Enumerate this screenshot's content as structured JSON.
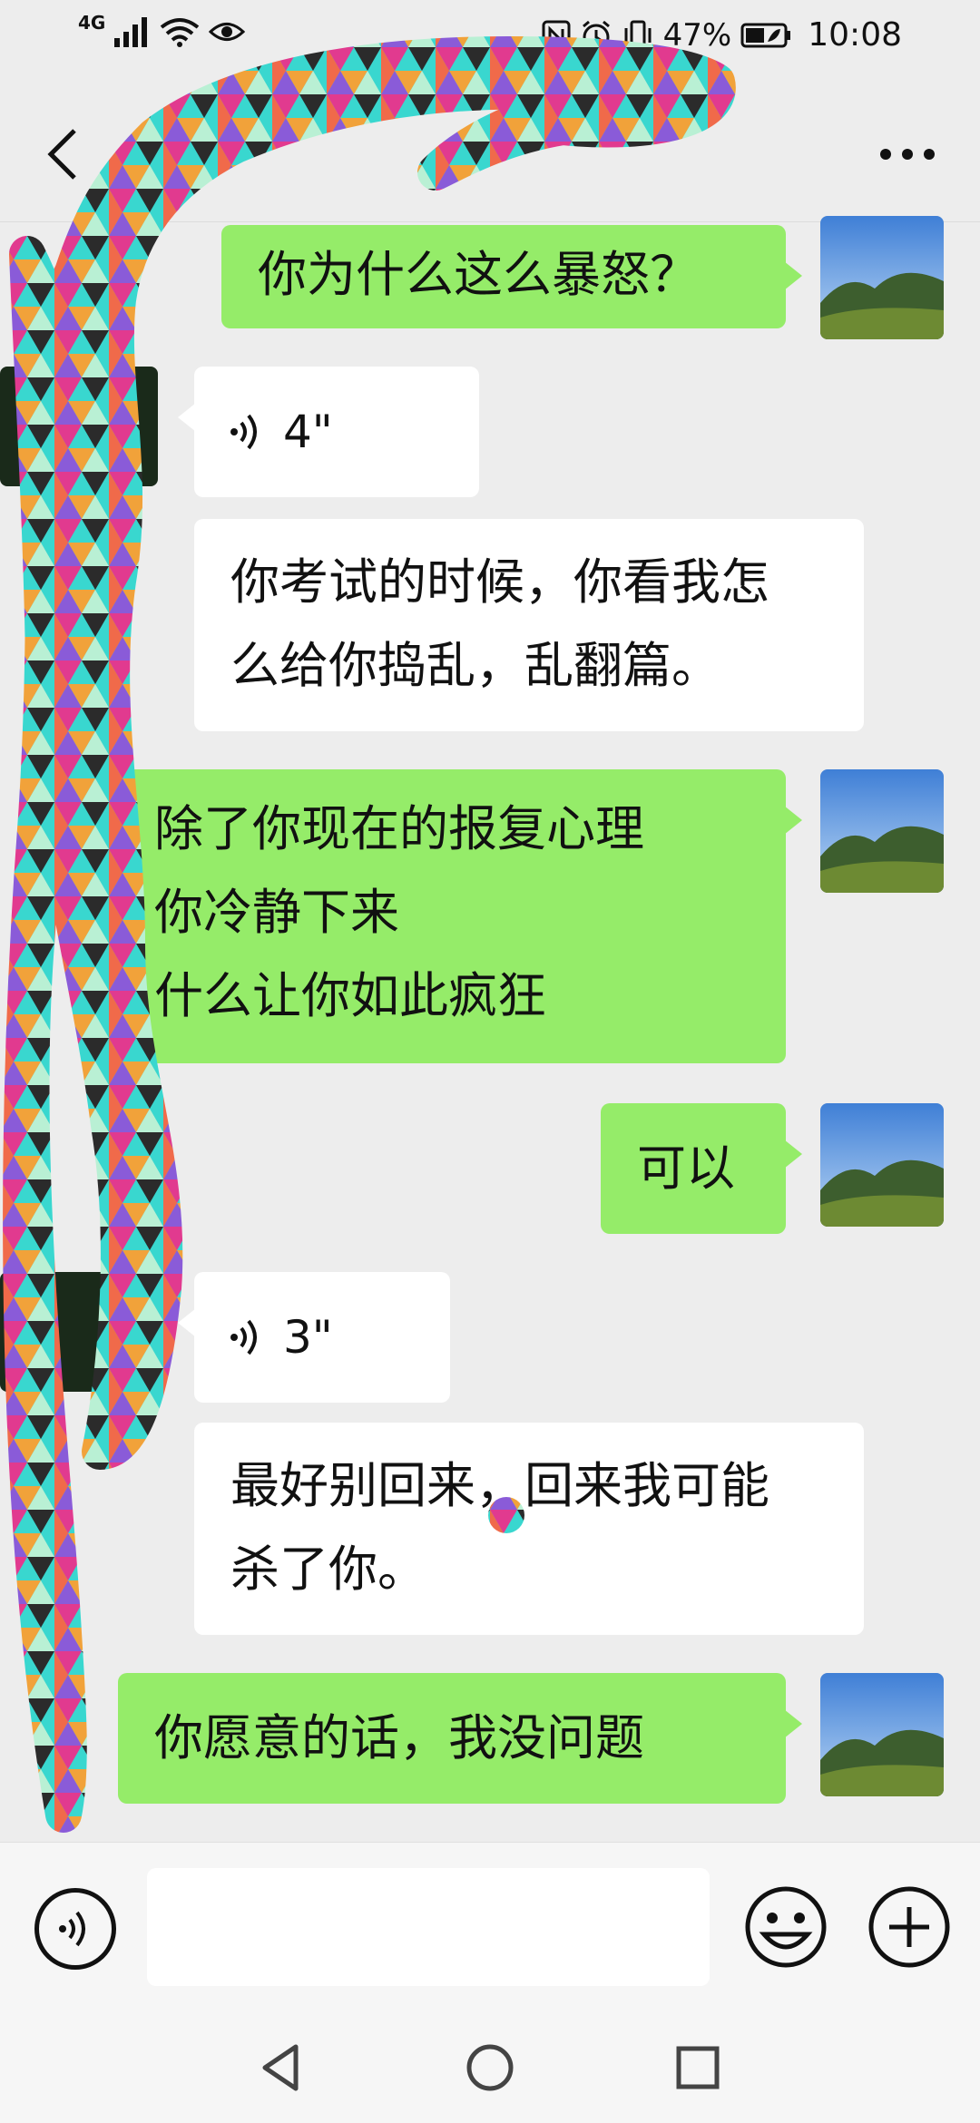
{
  "status_bar": {
    "network": "4G",
    "battery": "47%",
    "time": "10:08"
  },
  "header": {
    "back_icon": "chevron-left-icon",
    "more_icon": "ellipsis-icon"
  },
  "messages": [
    {
      "side": "me",
      "text": "你为什么这么暴怒？"
    },
    {
      "side": "other",
      "type": "voice",
      "duration": "4\""
    },
    {
      "side": "other",
      "text": "你考试的时候，你看我怎么给你捣乱，乱翻篇。",
      "lines": [
        "你考试的时候，你看我怎",
        "么给你捣乱，乱翻篇。"
      ]
    },
    {
      "side": "me",
      "text": "除了你现在的报复心理\n你冷静下来\n什么让你如此疯狂",
      "lines": [
        "除了你现在的报复心理",
        "你冷静下来",
        "什么让你如此疯狂"
      ]
    },
    {
      "side": "me",
      "text": "可以"
    },
    {
      "side": "other",
      "type": "voice",
      "duration": "3\""
    },
    {
      "side": "other",
      "text": "最好别回来，回来我可能杀了你。",
      "lines": [
        "最好别回来，回来我可能",
        "杀了你。"
      ]
    },
    {
      "side": "me",
      "text": "你愿意的话，我没问题"
    }
  ],
  "input_bar": {
    "placeholder": "",
    "voice_icon": "voice-toggle-icon",
    "emoji_icon": "emoji-icon",
    "plus_icon": "plus-icon"
  },
  "colors": {
    "my_bubble": "#95ec69",
    "other_bubble": "#ffffff",
    "background": "#ededed"
  }
}
